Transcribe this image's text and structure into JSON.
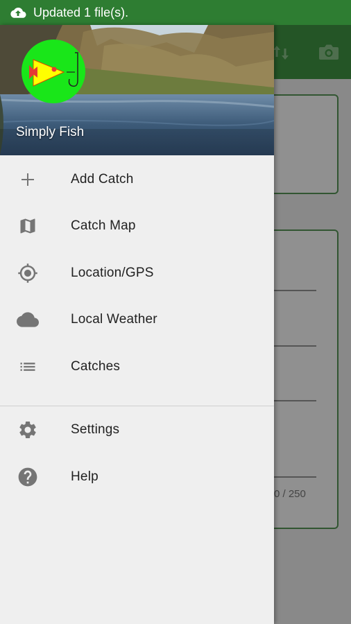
{
  "status_bar": {
    "notification_text": "Updated 1 file(s)."
  },
  "background_app": {
    "char_counter": "0 / 250",
    "icons": [
      "sort-icon",
      "camera-icon"
    ]
  },
  "drawer": {
    "app_name": "Simply Fish",
    "primary_items": [
      {
        "label": "Add Catch",
        "icon": "plus-icon"
      },
      {
        "label": "Catch Map",
        "icon": "map-icon"
      },
      {
        "label": "Location/GPS",
        "icon": "gps-icon"
      },
      {
        "label": "Local Weather",
        "icon": "cloud-icon"
      },
      {
        "label": "Catches",
        "icon": "list-icon"
      }
    ],
    "secondary_items": [
      {
        "label": "Settings",
        "icon": "gear-icon"
      },
      {
        "label": "Help",
        "icon": "help-icon"
      }
    ]
  },
  "colors": {
    "status_bar": "#2e7d32",
    "toolbar": "#3b8a3e",
    "icon_gray": "#757575",
    "logo_green": "#19e619",
    "logo_yellow": "#ffff00",
    "logo_red": "#e53935"
  }
}
